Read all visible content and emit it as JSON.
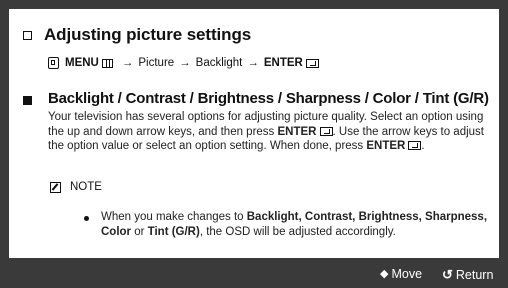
{
  "section": {
    "title": "Adjusting picture settings"
  },
  "menu_path": {
    "menu_label": "MENU",
    "path": "Picture",
    "path_item2": "Backlight",
    "enter_label": "ENTER",
    "arrow": "→"
  },
  "item": {
    "title": "Backlight / Contrast / Brightness / Sharpness / Color / Tint (G/R)",
    "body_part1": "Your television has several options for adjusting picture quality. Select an option using the up and down arrow keys, and then press ",
    "body_enter1": "ENTER",
    "body_part2": ". Use the arrow keys to adjust the option value or select an option setting. When done, press ",
    "body_enter2": "ENTER",
    "body_part3": "."
  },
  "note": {
    "label": "NOTE",
    "text_part1": "When you make changes to ",
    "text_bold1": "Backlight, Contrast, Brightness, Sharpness, Color",
    "text_part2": " or ",
    "text_bold2": "Tint (G/R)",
    "text_part3": ", the OSD will be adjusted accordingly."
  },
  "footer": {
    "move_icon": "◆",
    "move_label": "Move",
    "return_icon": "↺",
    "return_label": "Return"
  },
  "colors": {
    "background": "#3a3a3a",
    "panel": "#ffffff",
    "text": "#111111"
  }
}
